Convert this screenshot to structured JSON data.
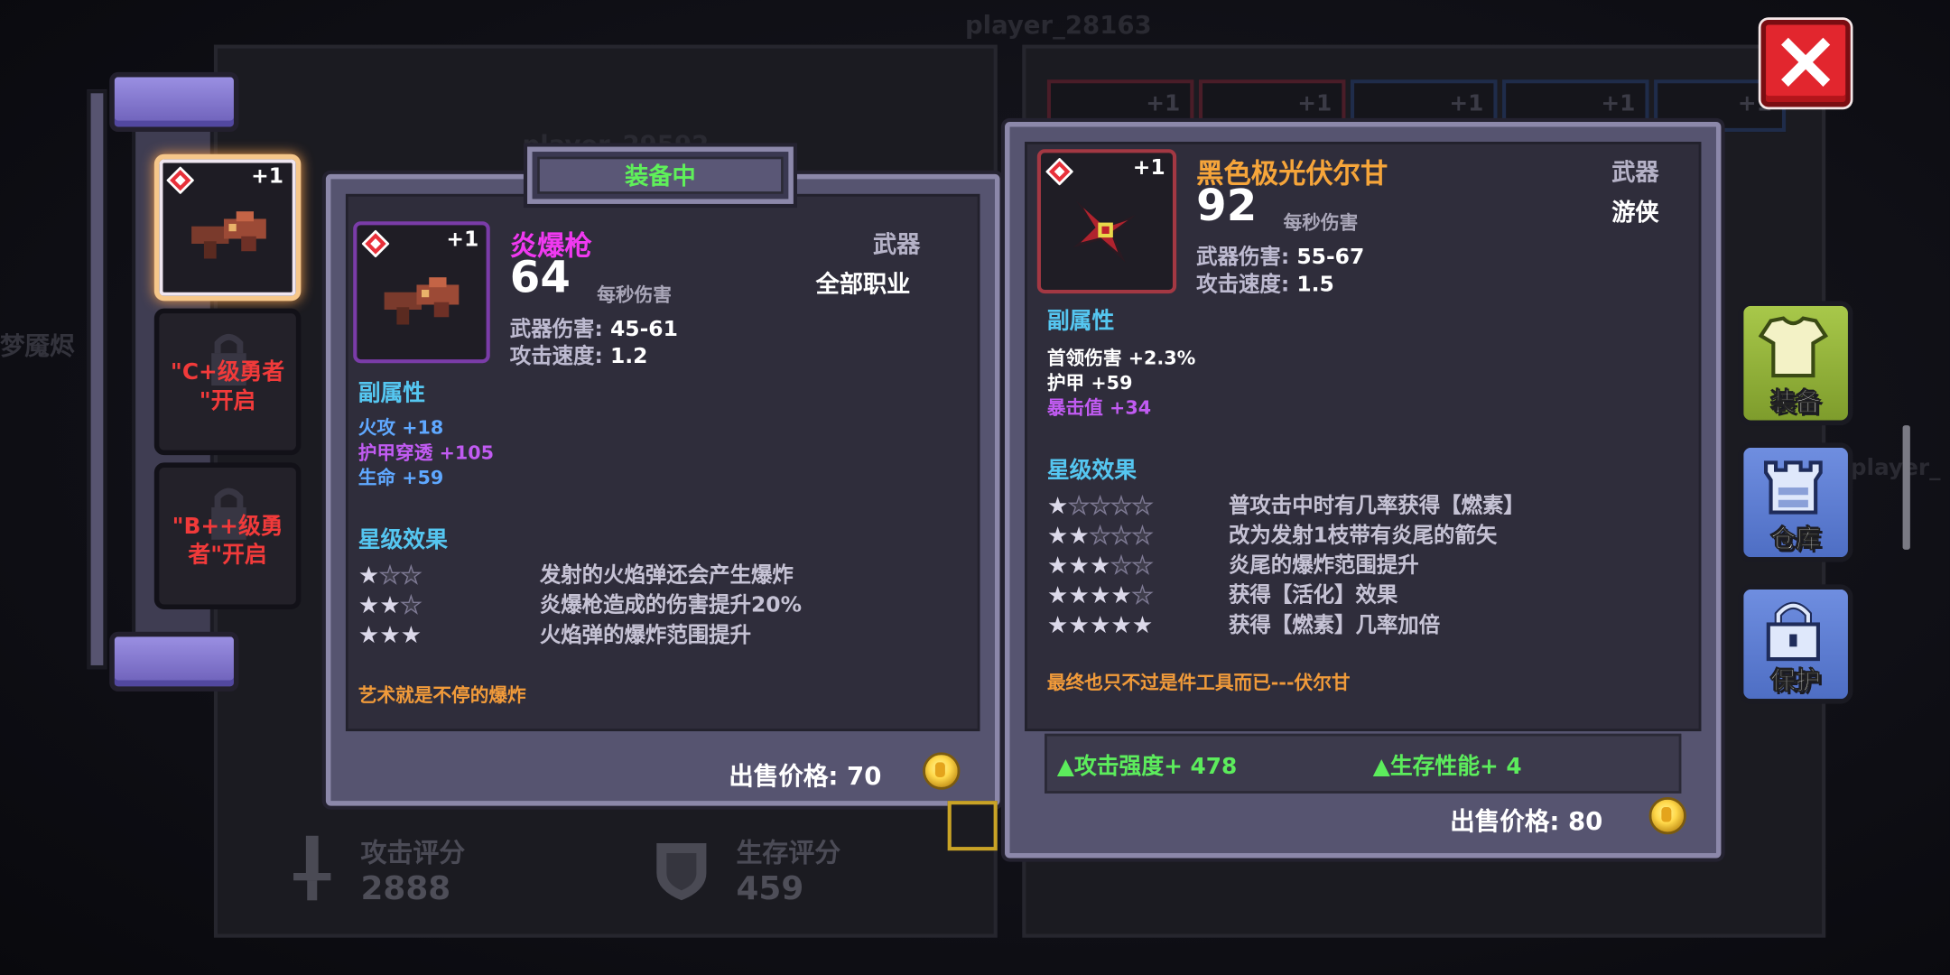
{
  "background": {
    "player_top": "player_28163",
    "player_mid": "player_29592",
    "player_right": "player_",
    "side_left_text": "梦魇烬",
    "attack_score": {
      "label": "攻击评分",
      "value": "2888"
    },
    "survival_score": {
      "label": "生存评分",
      "value": "459"
    },
    "slot_plus": [
      "+1",
      "+1",
      "+1",
      "+1",
      "+1"
    ]
  },
  "slots": {
    "selected_plus": "+1",
    "locked": [
      {
        "text_line1": "\"C+级勇者",
        "text_line2": "\"开启"
      },
      {
        "text_line1": "\"B++级勇",
        "text_line2": "者\"开启"
      }
    ]
  },
  "equipped_card": {
    "header": "装备中",
    "plus": "+1",
    "name": "炎爆枪",
    "name_color": "#f039f0",
    "dps": "64",
    "dps_label": "每秒伤害",
    "category": "武器",
    "class": "全部职业",
    "weapon_damage_label": "武器伤害:",
    "weapon_damage": "45-61",
    "attack_speed_label": "攻击速度:",
    "attack_speed": "1.2",
    "sub_title": "副属性",
    "sub_stats": [
      {
        "text": "火攻 +18",
        "color": "#5fa8ff"
      },
      {
        "text": "护甲穿透 +105",
        "color": "#c15bf2"
      },
      {
        "text": "生命 +59",
        "color": "#5fa8ff"
      }
    ],
    "star_title": "星级效果",
    "star_effects": [
      {
        "stars": 1,
        "max": 3,
        "desc": "发射的火焰弹还会产生爆炸"
      },
      {
        "stars": 2,
        "max": 3,
        "desc": "炎爆枪造成的伤害提升20%"
      },
      {
        "stars": 3,
        "max": 3,
        "desc": "火焰弹的爆炸范围提升"
      }
    ],
    "quote": "艺术就是不停的爆炸",
    "price_label": "出售价格: 70"
  },
  "compare_card": {
    "plus": "+1",
    "name": "黑色极光伏尔甘",
    "name_color": "#f6a53a",
    "dps": "92",
    "dps_label": "每秒伤害",
    "category": "武器",
    "class": "游侠",
    "weapon_damage_label": "武器伤害:",
    "weapon_damage": "55-67",
    "attack_speed_label": "攻击速度:",
    "attack_speed": "1.5",
    "sub_title": "副属性",
    "sub_stats": [
      {
        "text": "首领伤害 +2.3%",
        "color": "#ffffff"
      },
      {
        "text": "护甲 +59",
        "color": "#ffffff"
      },
      {
        "text": "暴击值 +34",
        "color": "#c15bf2"
      }
    ],
    "star_title": "星级效果",
    "star_effects": [
      {
        "stars": 1,
        "max": 5,
        "desc": "普攻击中时有几率获得【燃素】"
      },
      {
        "stars": 2,
        "max": 5,
        "desc": "改为发射1枝带有炎尾的箭矢"
      },
      {
        "stars": 3,
        "max": 5,
        "desc": "炎尾的爆炸范围提升"
      },
      {
        "stars": 4,
        "max": 5,
        "desc": "获得【活化】效果"
      },
      {
        "stars": 5,
        "max": 5,
        "desc": "获得【燃素】几率加倍"
      }
    ],
    "quote": "最终也只不过是件工具而已---伏尔甘",
    "attack_strength": "▲攻击强度+ 478",
    "survival_perf": "▲生存性能+ 4",
    "price_label": "出售价格: 80"
  },
  "side_buttons": {
    "equip": "装备",
    "storage": "仓库",
    "protect": "保护"
  },
  "icons": [
    "close-icon",
    "shirt-icon",
    "castle-icon",
    "lock-icon",
    "gem-icon",
    "sword-icon",
    "shield-icon",
    "coin-icon",
    "star-icon"
  ]
}
